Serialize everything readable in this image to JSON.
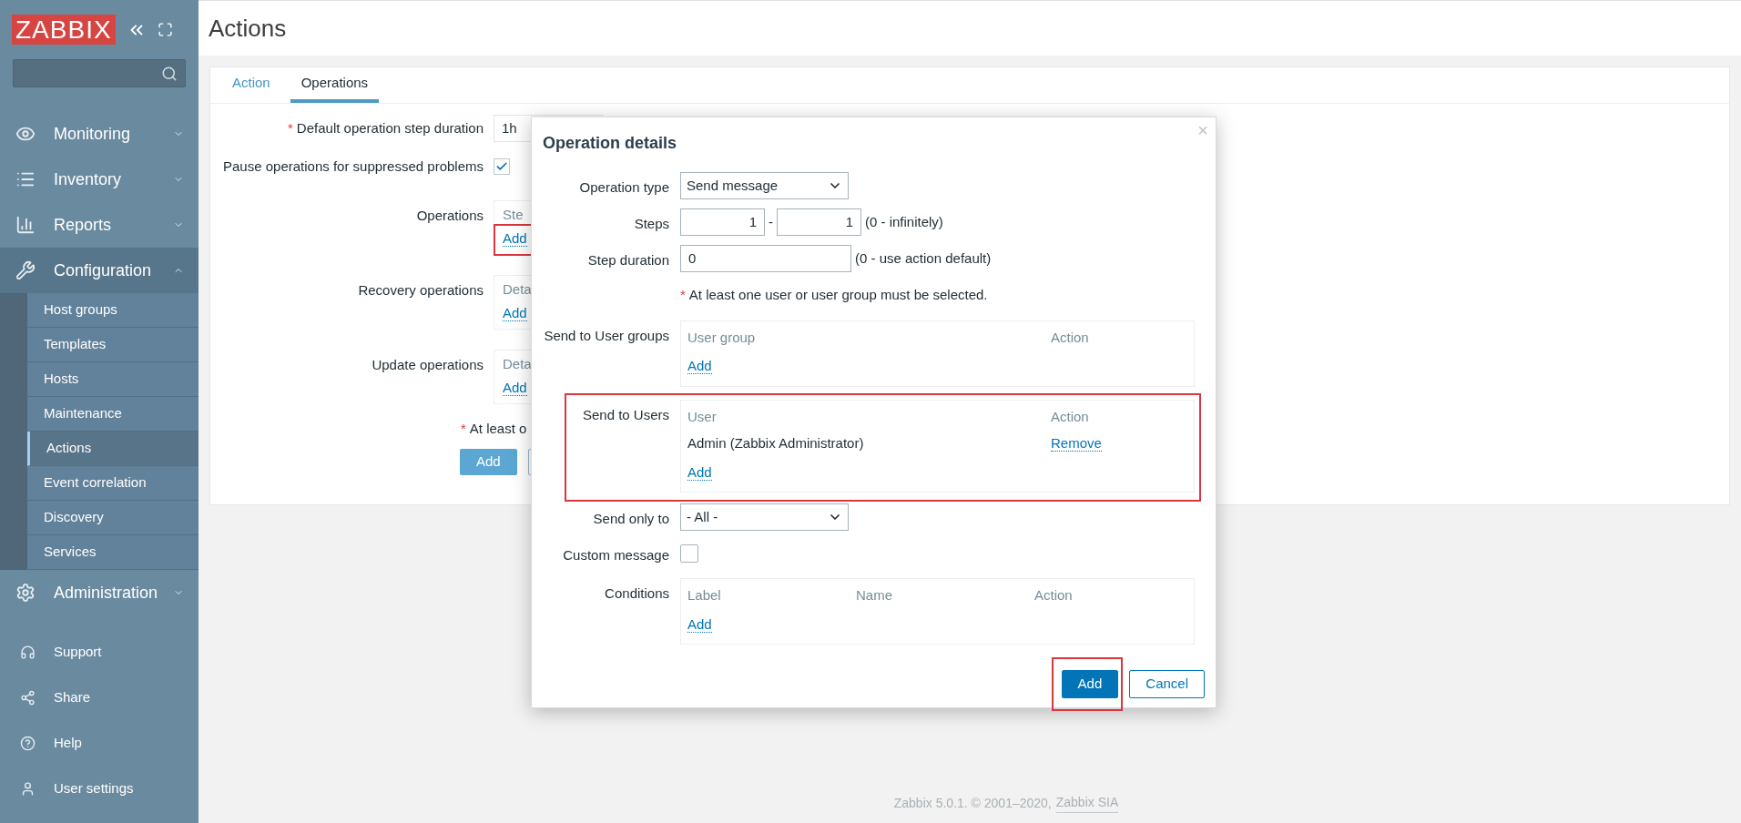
{
  "sidebar": {
    "logo": "ZABBIX",
    "menu": [
      {
        "label": "Monitoring",
        "expanded": false
      },
      {
        "label": "Inventory",
        "expanded": false
      },
      {
        "label": "Reports",
        "expanded": false
      },
      {
        "label": "Configuration",
        "expanded": true,
        "children": [
          {
            "label": "Host groups",
            "selected": false
          },
          {
            "label": "Templates",
            "selected": false
          },
          {
            "label": "Hosts",
            "selected": false
          },
          {
            "label": "Maintenance",
            "selected": false
          },
          {
            "label": "Actions",
            "selected": true
          },
          {
            "label": "Event correlation",
            "selected": false
          },
          {
            "label": "Discovery",
            "selected": false
          },
          {
            "label": "Services",
            "selected": false
          }
        ]
      },
      {
        "label": "Administration",
        "expanded": false
      }
    ],
    "user_menu": [
      "Support",
      "Share",
      "Help",
      "User settings"
    ]
  },
  "page": {
    "title": "Actions"
  },
  "tabs": [
    {
      "label": "Action",
      "selected": false
    },
    {
      "label": "Operations",
      "selected": true
    }
  ],
  "form": {
    "step_duration": {
      "mark": "*",
      "label": "Default operation step duration",
      "value": "1h"
    },
    "pause": {
      "label": "Pause operations for suppressed problems",
      "checked": true
    },
    "sections": [
      {
        "label": "Operations",
        "header": "Ste",
        "link": "Add",
        "highlighted": true
      },
      {
        "label": "Recovery operations",
        "header": "Deta",
        "link": "Add",
        "highlighted": false
      },
      {
        "label": "Update operations",
        "header": "Deta",
        "link": "Add",
        "highlighted": false
      }
    ],
    "note": {
      "mark": "*",
      "text": "At least o"
    },
    "button": "Add"
  },
  "dialog": {
    "title": "Operation details",
    "close": "×",
    "fields": [
      {
        "kind": "select",
        "label": "Operation type",
        "value": "Send message"
      },
      {
        "kind": "range",
        "label": "Steps",
        "from": "1",
        "separator": "-",
        "to": "1",
        "hint": "(0 - infinitely)"
      },
      {
        "kind": "text",
        "label": "Step duration",
        "value": "0",
        "hint": "(0 - use action default)"
      },
      {
        "kind": "note",
        "mark": "*",
        "text": "At least one user or user group must be selected."
      },
      {
        "kind": "table",
        "label": "Send to User groups",
        "columns": [
          "User group",
          "Action"
        ],
        "link": "Add",
        "highlighted": false
      },
      {
        "kind": "table",
        "label": "Send to Users",
        "columns": [
          "User",
          "Action"
        ],
        "rows": [
          {
            "name": "Admin (Zabbix Administrator)",
            "action": "Remove"
          }
        ],
        "link": "Add",
        "highlighted": true
      },
      {
        "kind": "select",
        "label": "Send only to",
        "value": "- All -"
      },
      {
        "kind": "checkbox",
        "label": "Custom message",
        "checked": false
      },
      {
        "kind": "table",
        "label": "Conditions",
        "columns": [
          "Label",
          "Name",
          "Action"
        ],
        "link": "Add",
        "highlighted": false
      }
    ],
    "buttons": [
      {
        "label": "Add",
        "primary": true,
        "highlighted": true
      },
      {
        "label": "Cancel",
        "primary": false,
        "highlighted": false
      }
    ]
  },
  "footer": {
    "text": "Zabbix 5.0.1. © 2001–2020,",
    "link": "Zabbix SIA"
  }
}
